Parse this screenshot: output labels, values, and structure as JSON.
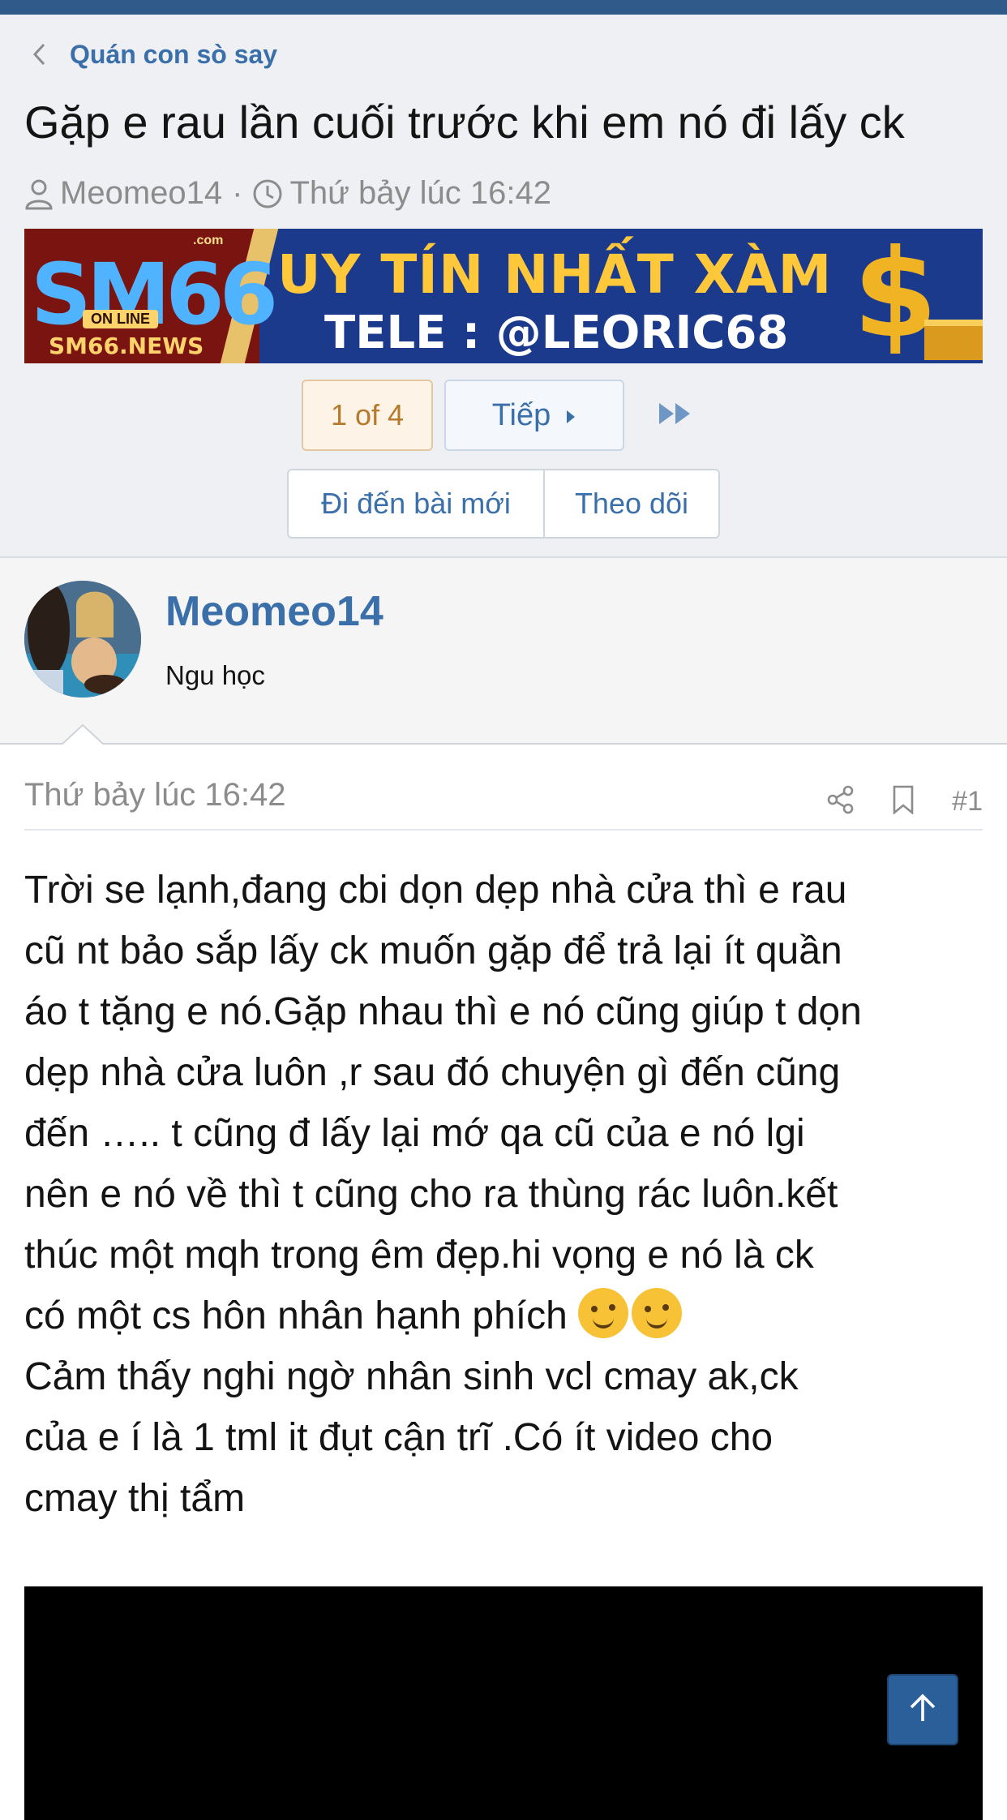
{
  "thread": {
    "forum": "Quán con sò say",
    "title": "Gặp e rau lần cuối trước khi em nó đi lấy ck",
    "author": "Meomeo14",
    "dot": "·",
    "time": "Thứ bảy lúc 16:42"
  },
  "banner": {
    "logo": "SM66",
    "online": "ON LINE",
    "site": "SM66.NEWS",
    "com": ".com",
    "line1": "UY TÍN NHẤT XÀM",
    "line2": "TELE : @LEORIC68",
    "coin": "$"
  },
  "pagination": {
    "current": "1 of 4",
    "next": "Tiếp"
  },
  "actions": {
    "new_posts": "Đi đến bài mới",
    "follow": "Theo dõi"
  },
  "post": {
    "username": "Meomeo14",
    "user_title": "Ngu học",
    "date": "Thứ bảy lúc 16:42",
    "number": "#1",
    "lines": [
      "Trời se lạnh,đang cbi dọn dẹp nhà cửa thì e rau",
      "cũ nt bảo sắp lấy ck muốn gặp để trả lại ít quần",
      "áo t tặng e nó.Gặp nhau thì e nó cũng giúp t dọn",
      "dẹp nhà cửa luôn ,r sau đó chuyện gì đến cũng",
      "đến ….. t cũng đ lấy lại mớ qa cũ của e nó lgi",
      "nên e nó về thì t cũng cho ra thùng rác luôn.kết",
      "thúc một mqh trong êm đẹp.hi vọng e nó là ck",
      "có một cs hôn nhân hạnh phích",
      "Cảm thấy nghi ngờ nhân sinh vcl cmay ak,ck",
      "của e í là 1 tml it đụt cận trĩ .Có ít video cho",
      "cmay thị tẩm"
    ]
  },
  "colors": {
    "accent": "#3b6fa9",
    "topbar": "#2f5a8a",
    "header_bg": "#eef0f3",
    "pager_current_text": "#b57a2c",
    "scrolltop_bg": "#2a5f99"
  },
  "icons": [
    "chevron-left-icon",
    "user-icon",
    "clock-icon",
    "caret-right-icon",
    "fast-forward-icon",
    "share-icon",
    "bookmark-icon",
    "arrow-up-icon",
    "smiley-emoji"
  ]
}
